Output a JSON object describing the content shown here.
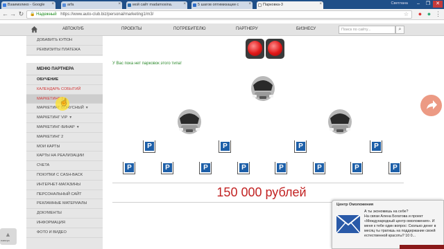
{
  "browser": {
    "tabs": [
      {
        "label": "Взаимолико - Google",
        "favicon_color": "#3b7de0"
      },
      {
        "label": "arfa",
        "favicon_color": "#5c8fd8"
      },
      {
        "label": "мой сайт madamosina.",
        "favicon_color": "#2c6fb0"
      },
      {
        "label": "5 шагов оптимизации с",
        "favicon_color": "#2e6cc7"
      },
      {
        "label": "Парковка-3",
        "favicon_color": "#ffffff"
      }
    ],
    "user_label": "Светлана",
    "window_buttons": [
      "–",
      "❐",
      "✕"
    ],
    "secure_label": "Надежный",
    "url": "https://www.auto-club.biz/personal/marketing1/m3/"
  },
  "site_nav": {
    "items": [
      "АВТОКЛУБ",
      "ПРОЕКТЫ",
      "ПОТРЕБИТЕЛЮ",
      "ПАРТНЕРУ",
      "БИЗНЕСУ"
    ],
    "search_placeholder": "Поиск по сайту..."
  },
  "sidebar": {
    "top_items": [
      "ДОБАВИТЬ КУПОН",
      "РЕКВИЗИТЫ ПЛАТЕЖА"
    ],
    "partner_header": "МЕНЮ ПАРТНЕРА",
    "partner_items": [
      {
        "label": "ОБУЧЕНИЕ",
        "style": "bold"
      },
      {
        "label": "КАЛЕНДАРЬ СОБЫТИЙ",
        "style": "red"
      },
      {
        "label": "МАРКЕТИНГ 3",
        "style": "red-hl"
      },
      {
        "label": "МАРКЕТИНГ БОНУСНЫЙ",
        "caret": true
      },
      {
        "label": "МАРКЕТИНГ VIP",
        "caret": true
      },
      {
        "label": "МАРКЕТИНГ-БИНАР",
        "caret": true
      },
      {
        "label": "МАРКЕТИНГ 2"
      },
      {
        "label": "МОИ КАРТЫ"
      },
      {
        "label": "КАРТЫ НА РЕАЛИЗАЦИИ"
      },
      {
        "label": "СЧЕТА"
      },
      {
        "label": "ПОКУПКИ С CASH-BACK"
      },
      {
        "label": "ИНТЕРНЕТ-МАГАЗИНЫ"
      },
      {
        "label": "ПЕРСОНАЛЬНЫЙ САЙТ"
      },
      {
        "label": "РЕКЛАМНЫЕ МАТЕРИАЛЫ"
      },
      {
        "label": "ДОКУМЕНТЫ"
      },
      {
        "label": "ИНФОРМАЦИЯ"
      },
      {
        "label": "ФОТО И ВИДЕО"
      }
    ]
  },
  "up_widget_label": "наверх",
  "main": {
    "notice": "У Вас пока нет парковок этого типа!",
    "price": "150 000 рублей",
    "parking_letter": "P",
    "colors": {
      "spot": "#1d5fa8",
      "price": "#c22323",
      "notice": "#2d8a2d"
    }
  },
  "popup": {
    "title": "Центр Омоложения",
    "lines": [
      "А ты экономишь на себе?",
      "На связи Алена Богатова и проект",
      "«Международный центр омоложения». И",
      "меня к тебе один вопрос: Сколько денег в",
      "месяц ты тратишь на поддержание своей",
      "естественной красоты? 10 0..."
    ]
  }
}
